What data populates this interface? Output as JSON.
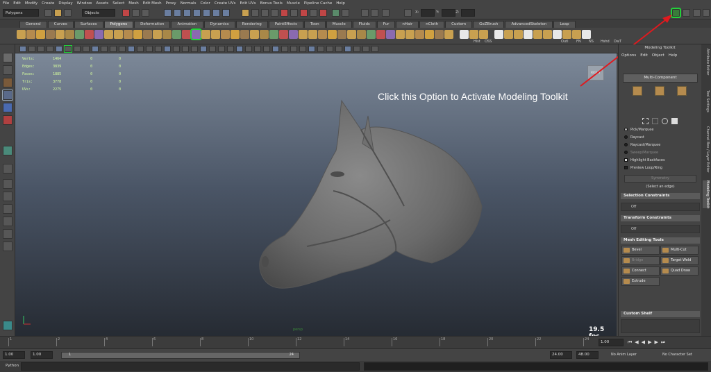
{
  "menubar": [
    "File",
    "Edit",
    "Modify",
    "Create",
    "Display",
    "Window",
    "Assets",
    "Select",
    "Mesh",
    "Edit Mesh",
    "Proxy",
    "Normals",
    "Color",
    "Create UVs",
    "Edit UVs",
    "Bonus Tools",
    "Muscle",
    "Pipeline Cache",
    "Help"
  ],
  "status": {
    "mode": "Polygons",
    "select_mode": "Objects",
    "x_label": "X:",
    "y_label": "Y:",
    "z_label": "Z:"
  },
  "shelf_tabs": [
    "General",
    "Curves",
    "Surfaces",
    "Polygons",
    "Deformation",
    "Animation",
    "Dynamics",
    "Rendering",
    "PaintEffects",
    "Toon",
    "Muscle",
    "Fluids",
    "Fur",
    "nHair",
    "nCloth",
    "Custom",
    "GoZBrush",
    "AdvancedSkeleton",
    "Leap"
  ],
  "shelf_active": "Polygons",
  "shelf_labels": {
    "hist": "Hist",
    "oss": "OSS",
    "outl": "Outl",
    "fn": "FN",
    "ns": "NS",
    "hshd": "Hshd",
    "dw": "DwT"
  },
  "hud": {
    "rows": [
      {
        "label": "Verts:",
        "v1": "1464",
        "v2": "0",
        "v3": "0"
      },
      {
        "label": "Edges:",
        "v1": "3839",
        "v2": "0",
        "v3": "0"
      },
      {
        "label": "Faces:",
        "v1": "1885",
        "v2": "0",
        "v3": "0"
      },
      {
        "label": "Tris:",
        "v1": "3778",
        "v2": "0",
        "v3": "0"
      },
      {
        "label": "UVs:",
        "v1": "2275",
        "v2": "0",
        "v3": "0"
      }
    ],
    "fps": "19.5 fps",
    "camera": "persp",
    "viewcube": "RIGHT"
  },
  "annotation": "Click this Option to Activate Modeling Toolkit",
  "toolkit": {
    "title": "Modeling Toolkit",
    "menu": [
      "Options",
      "Edit",
      "Object",
      "Help"
    ],
    "mode_label": "Multi-Component",
    "select_options": [
      "Pick/Marquee",
      "Raycast",
      "Raycast/Marquee",
      "Sweep/Marquee",
      "Highlight Backfaces",
      "Preview Loop/Ring"
    ],
    "symmetry_label": "Symmetry",
    "hint": "(Select an edge)",
    "selection_constraints": "Selection Constraints",
    "transform_constraints": "Transform Constraints",
    "off_label": "Off",
    "mesh_editing": "Mesh Editing Tools",
    "tools": [
      "Bevel",
      "Multi-Cut",
      "Bridge",
      "Target Weld",
      "Connect",
      "Quad Draw",
      "Extrude"
    ],
    "custom_shelf": "Custom Shelf"
  },
  "side_tabs": [
    "Attribute Editor",
    "Tool Settings",
    "Channel Box / Layer Editor",
    "Modeling Toolkit"
  ],
  "timeline": {
    "ticks": [
      "1",
      "2",
      "4",
      "6",
      "8",
      "10",
      "12",
      "14",
      "16",
      "18",
      "20",
      "22",
      "24"
    ],
    "current": "1.00"
  },
  "range": {
    "start": "1.00",
    "start2": "1.00",
    "range_start": "1",
    "range_end": "24",
    "end": "24.00",
    "end2": "48.00",
    "anim_layer": "No Anim Layer",
    "char_set": "No Character Set"
  },
  "cmd": {
    "language": "Python"
  },
  "colors": {
    "highlight": "#23d23a",
    "arrow": "#e0191e",
    "hud_text": "#d7ff9d"
  }
}
